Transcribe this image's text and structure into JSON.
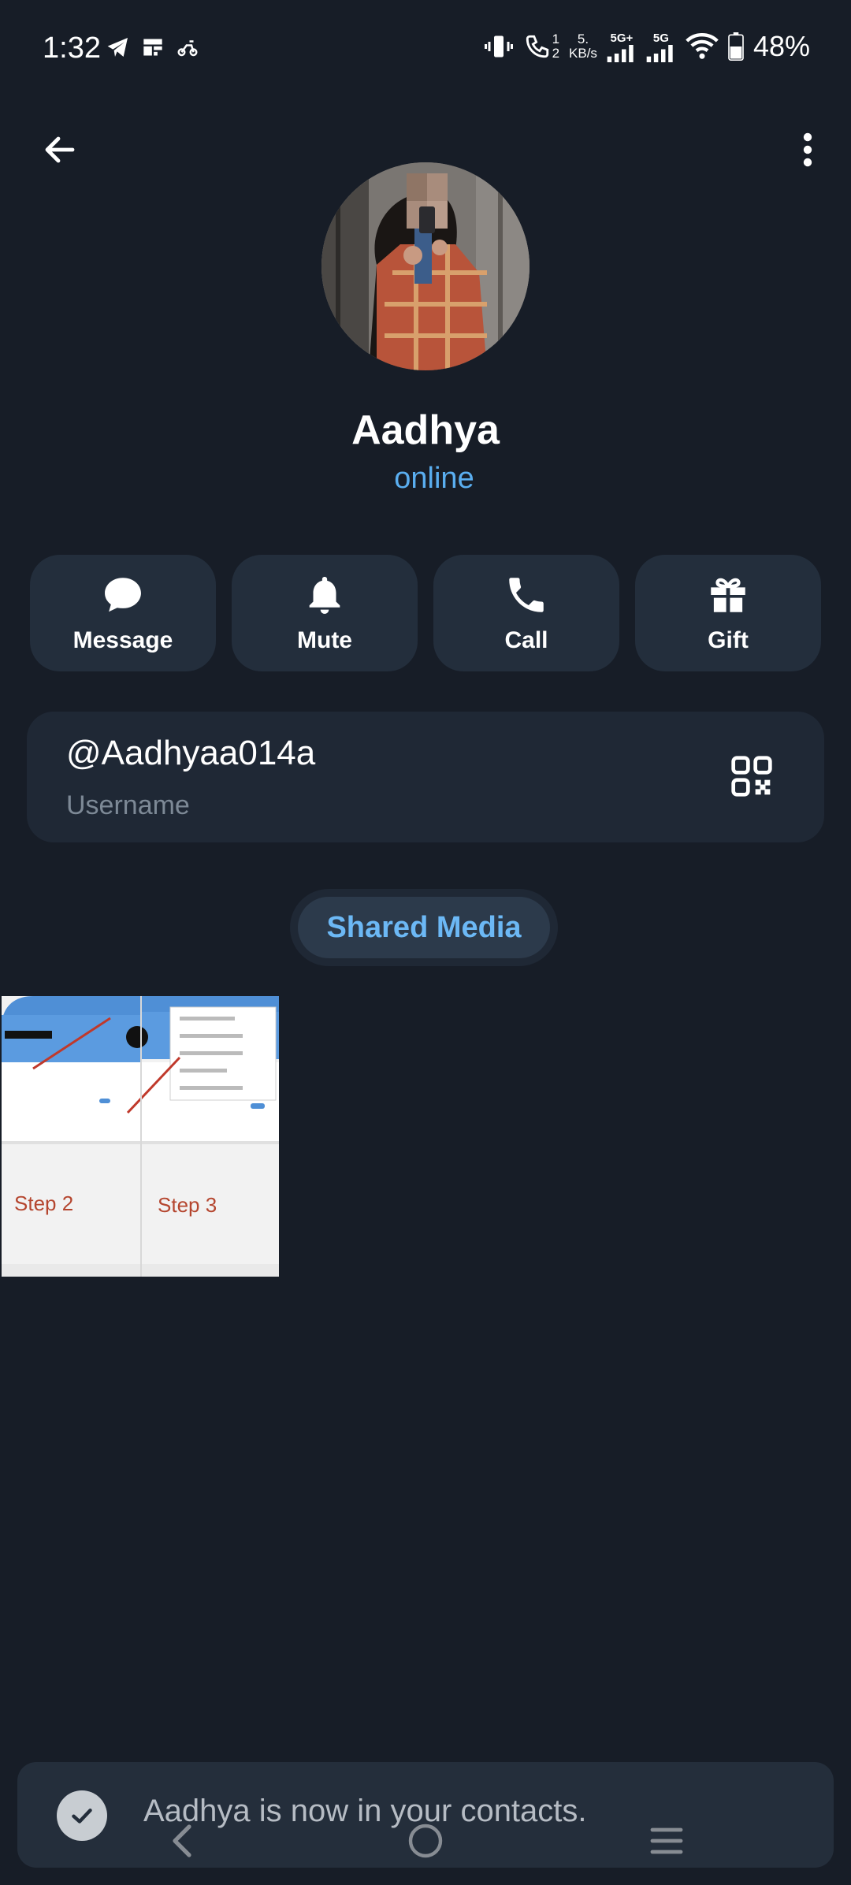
{
  "status_bar": {
    "time": "1:32",
    "network_speed_top": "5.",
    "network_speed_unit": "KB/s",
    "sim1_label": "5G+",
    "sim2_label": "5G",
    "call_sim_top": "1",
    "call_sim_bottom": "2",
    "battery_percent": "48%",
    "icons": [
      "telegram-icon",
      "app-icon",
      "moped-icon",
      "vibrate-icon",
      "wifi-call-icon",
      "signal-icon",
      "signal-icon",
      "wifi-icon",
      "battery-icon"
    ]
  },
  "header": {
    "back_icon": "arrow-left-icon",
    "menu_icon": "more-vertical-icon"
  },
  "profile": {
    "name": "Aadhya",
    "status": "online",
    "status_color": "#5aaef0"
  },
  "actions": [
    {
      "label": "Message",
      "icon": "message-icon"
    },
    {
      "label": "Mute",
      "icon": "bell-icon"
    },
    {
      "label": "Call",
      "icon": "phone-icon"
    },
    {
      "label": "Gift",
      "icon": "gift-icon"
    }
  ],
  "username": {
    "value": "@Aadhyaa014a",
    "caption": "Username",
    "qr_icon": "qr-code-icon"
  },
  "shared_media": {
    "label": "Shared Media",
    "thumbnail": {
      "step_left": "Step 2",
      "step_right": "Step 3"
    }
  },
  "toast": {
    "text": "Aadhya is now in your contacts.",
    "icon": "check-circle-icon"
  },
  "colors": {
    "background": "#171d27",
    "card": "#1f2835",
    "button": "#232e3c",
    "accent": "#5aaef0"
  }
}
